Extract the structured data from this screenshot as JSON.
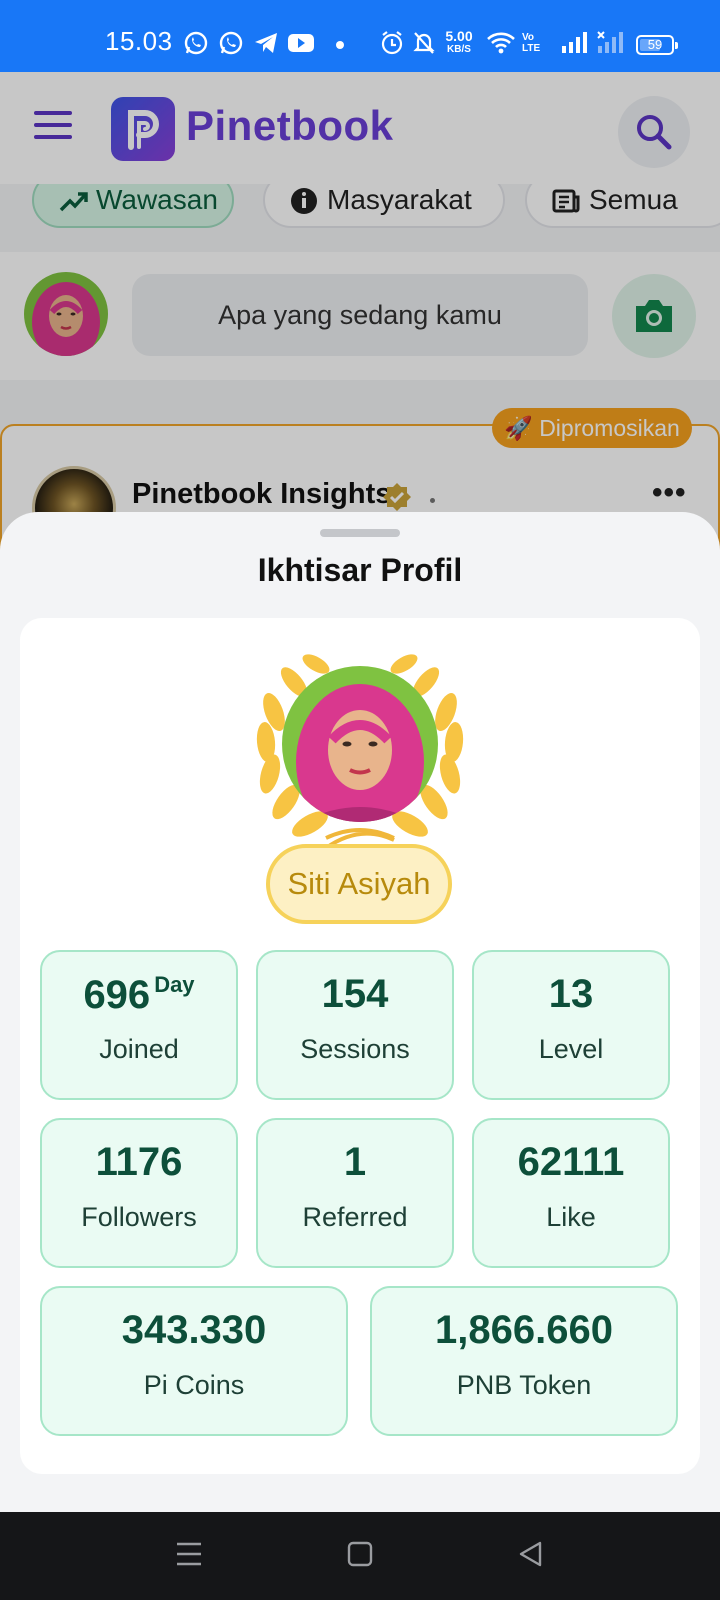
{
  "status_bar": {
    "time": "15.03",
    "net_speed": "5.00",
    "net_speed_unit": "KB/S",
    "volte_label": "Vo LTE",
    "battery": "59",
    "icons": [
      "whatsapp-icon",
      "whatsapp-business-icon",
      "telegram-icon",
      "youtube-icon",
      "alarm-icon",
      "mute-icon",
      "wifi-icon",
      "signal-icon"
    ]
  },
  "app": {
    "brand": "Pinetbook",
    "brand_color": "#6a3fd6",
    "accent_green": "#0d4f3a",
    "chips": [
      {
        "label": "Wawasan",
        "icon": "trending-icon",
        "active": true
      },
      {
        "label": "Masyarakat",
        "icon": "info-icon",
        "active": false
      },
      {
        "label": "Semua",
        "icon": "news-icon",
        "active": false
      }
    ],
    "composer_placeholder": "Apa yang sedang kamu",
    "post": {
      "badge": "🚀 Dipromosikan",
      "author": "Pinetbook Insights",
      "more": "•••"
    }
  },
  "sheet": {
    "title": "Ikhtisar Profil",
    "user_name": "Siti Asiyah",
    "stats": [
      {
        "value": "696",
        "suffix": "Day",
        "label": "Joined"
      },
      {
        "value": "154",
        "label": "Sessions"
      },
      {
        "value": "13",
        "label": "Level"
      },
      {
        "value": "1176",
        "label": "Followers"
      },
      {
        "value": "1",
        "label": "Referred"
      },
      {
        "value": "62111",
        "label": "Like"
      },
      {
        "value": "343.330",
        "label": "Pi Coins"
      },
      {
        "value": "1,866.660",
        "label": "PNB Token"
      }
    ]
  }
}
